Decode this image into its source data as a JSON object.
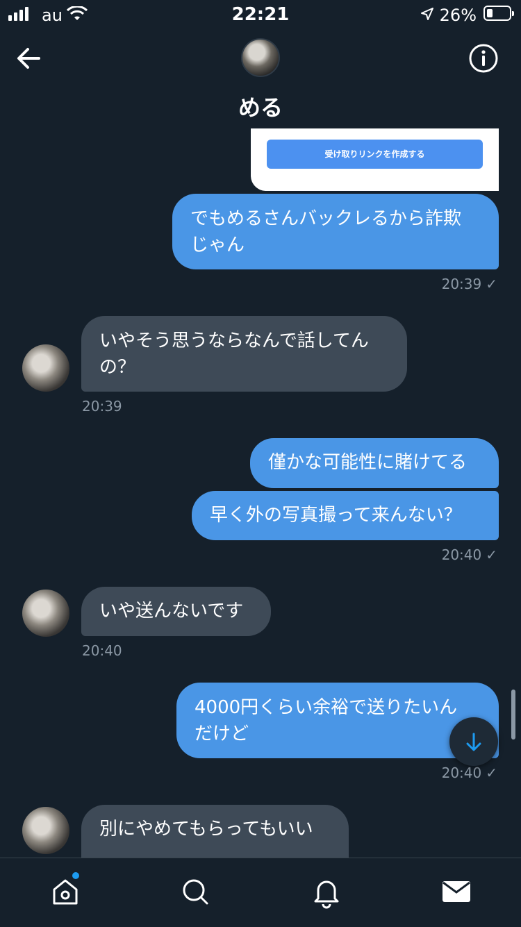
{
  "status_bar": {
    "carrier": "au",
    "time": "22:21",
    "battery_percent": "26%",
    "battery_level": 0.26
  },
  "header": {
    "name": "める"
  },
  "shared_card": {
    "button_label": "受け取りリンクを作成する"
  },
  "messages": [
    {
      "side": "out",
      "lines": [
        "でもめるさんバックレるから詐欺",
        "じゃん"
      ],
      "time": "20:39",
      "read_check": "✓"
    },
    {
      "side": "in",
      "lines": [
        "いやそう思うならなんで話してん",
        "の？"
      ],
      "time": "20:39"
    },
    {
      "side": "out",
      "lines": [
        "僅かな可能性に賭けてる"
      ]
    },
    {
      "side": "out",
      "lines": [
        "早く外の写真撮って来んない？"
      ],
      "time": "20:40",
      "read_check": "✓"
    },
    {
      "side": "in",
      "lines": [
        "いや送んないです"
      ],
      "time": "20:40"
    },
    {
      "side": "out",
      "lines": [
        "4000円くらい余裕で送りたいん",
        "だけど"
      ],
      "time": "20:40",
      "read_check": "✓"
    },
    {
      "side": "in",
      "lines": [
        "別にやめてもらってもいい"
      ]
    }
  ],
  "icons": {
    "back": "arrow-left-icon",
    "info": "info-icon",
    "scroll": "arrow-down-icon",
    "tabs": [
      "home-icon",
      "search-icon",
      "bell-icon",
      "mail-icon"
    ]
  },
  "colors": {
    "background": "#15202b",
    "outgoing_bubble": "#4a96e6",
    "incoming_bubble": "#3e4a57",
    "accent": "#1d9bf0"
  }
}
